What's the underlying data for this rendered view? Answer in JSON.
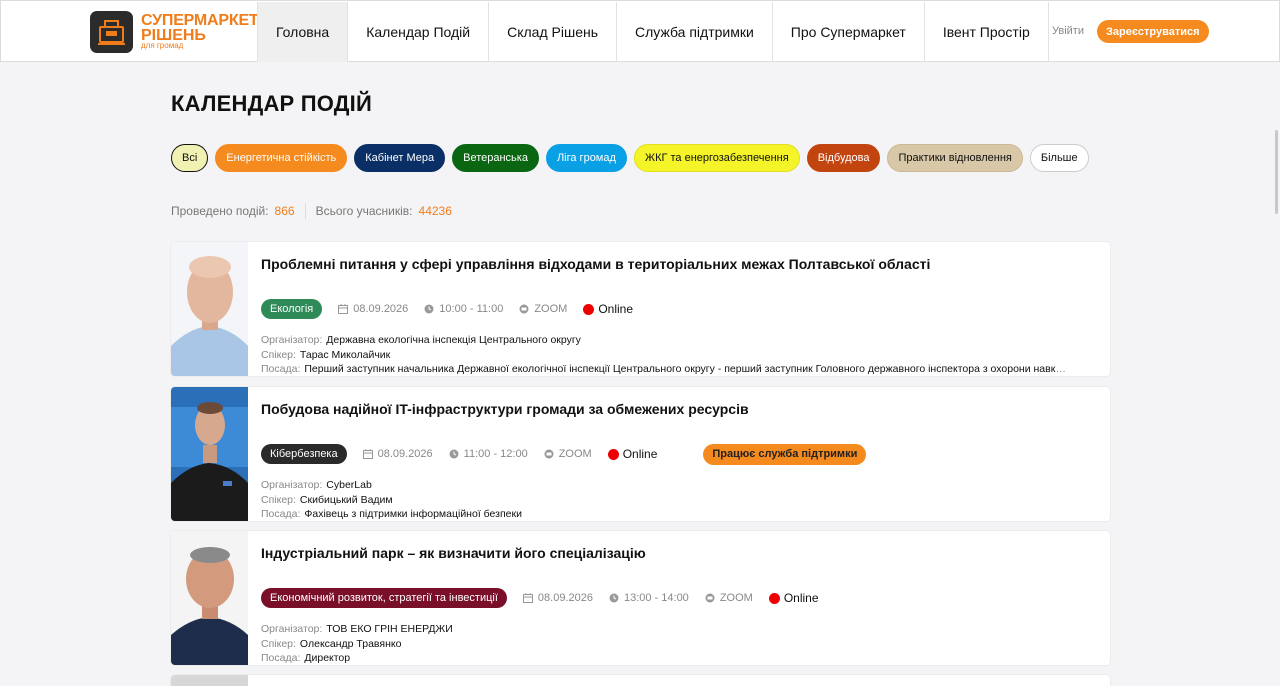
{
  "logo": {
    "line1": "СУПЕРМАРКЕТ",
    "line2": "РІШЕНЬ",
    "line3": "для громад"
  },
  "nav": [
    {
      "label": "Головна",
      "active": true
    },
    {
      "label": "Календар Подій"
    },
    {
      "label": "Склад Рішень"
    },
    {
      "label": "Служба підтримки"
    },
    {
      "label": "Про Супермаркет"
    },
    {
      "label": "Івент Простір"
    }
  ],
  "auth": {
    "login": "Увійти",
    "register": "Зареєструватися"
  },
  "page": {
    "title": "КАЛЕНДАР ПОДІЙ"
  },
  "filters": [
    {
      "label": "Всі",
      "bg": "#f1f1b4",
      "fg": "#111111",
      "border": "#111111"
    },
    {
      "label": "Енергетична стійкість",
      "bg": "#f58a1f",
      "fg": "#ffffff",
      "border": "#f58a1f"
    },
    {
      "label": "Кабінет Мера",
      "bg": "#0a2e66",
      "fg": "#ffffff",
      "border": "#0a2e66"
    },
    {
      "label": "Ветеранська",
      "bg": "#0b6611",
      "fg": "#ffffff",
      "border": "#0b6611"
    },
    {
      "label": "Ліга громад",
      "bg": "#0aa0e6",
      "fg": "#ffffff",
      "border": "#0aa0e6"
    },
    {
      "label": "ЖКГ та енергозабезпечення",
      "bg": "#f4f428",
      "fg": "#111111",
      "border": "#e0e020"
    },
    {
      "label": "Відбудова",
      "bg": "#c2440f",
      "fg": "#ffffff",
      "border": "#c2440f"
    },
    {
      "label": "Практики відновлення",
      "bg": "#d8c8a8",
      "fg": "#111111",
      "border": "#cbb994"
    },
    {
      "label": "Більше",
      "bg": "#ffffff",
      "fg": "#111111",
      "border": "#cccccc"
    }
  ],
  "stats": {
    "events_label": "Проведено подій:",
    "events_value": "866",
    "participants_label": "Всього учасників:",
    "participants_value": "44236"
  },
  "labels": {
    "organizer": "Організатор:",
    "speaker": "Спікер:",
    "position": "Посада:"
  },
  "events": [
    {
      "title": "Проблемні питання у сфері управління відходами в територіальних межах Полтавської області",
      "tag": "Екологія",
      "tag_color": "#2e8b57",
      "date": "08.09.2026",
      "time": "10:00 - 11:00",
      "platform": "ZOOM",
      "mode": "Online",
      "organizer": "Державна екологічна інспекція Центрального округу",
      "speaker": "Тарас Миколайчик",
      "position": "Перший заступник начальника Державної екологічної інспекції Центрального округу - перший заступник Головного державного інспектора з охорони навколишнього природного середовища"
    },
    {
      "title": "Побудова надійної IT-інфраструктури громади за обмежених ресурсів",
      "tag": "Кібербезпека",
      "tag_color": "#2a2a2a",
      "date": "08.09.2026",
      "time": "11:00 - 12:00",
      "platform": "ZOOM",
      "mode": "Online",
      "badge": "Працює служба підтримки",
      "organizer": "CyberLab",
      "speaker": "Скибицький Вадим",
      "position": "Фахівець з підтримки інформаційної безпеки"
    },
    {
      "title": "Індустріальний парк – як визначити його спеціалізацію",
      "tag": "Економічний розвиток, стратегії та інвестиції",
      "tag_color": "#7a0f2a",
      "date": "08.09.2026",
      "time": "13:00 - 14:00",
      "platform": "ZOOM",
      "mode": "Online",
      "organizer": "ТОВ ЕКО ГРІН ЕНЕРДЖИ",
      "speaker": "Олександр Травянко",
      "position": "Директор"
    }
  ]
}
